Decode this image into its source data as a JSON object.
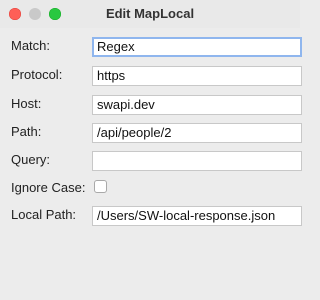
{
  "window": {
    "title": "Edit MapLocal"
  },
  "form": {
    "match": {
      "label": "Match:",
      "value": "Regex"
    },
    "protocol": {
      "label": "Protocol:",
      "value": "https"
    },
    "host": {
      "label": "Host:",
      "value": "swapi.dev"
    },
    "path": {
      "label": "Path:",
      "value": "/api/people/2"
    },
    "query": {
      "label": "Query:",
      "value": ""
    },
    "ignore_case": {
      "label": "Ignore Case:",
      "checked": false
    },
    "local_path": {
      "label": "Local Path:",
      "value": "/Users/SW-local-response.json"
    }
  },
  "colors": {
    "close": "#fe5f57",
    "minimize": "#c9c9c9",
    "maximize": "#28c840",
    "focus_ring": "#8fb6ee"
  }
}
